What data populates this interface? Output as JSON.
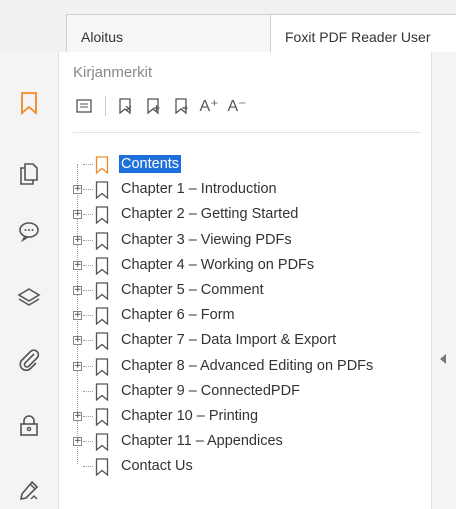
{
  "tabs": {
    "home": "Aloitus",
    "document": "Foxit PDF Reader User"
  },
  "panel": {
    "title": "Kirjanmerkit"
  },
  "icons": {
    "sidebar": [
      "bookmark-icon",
      "pages-icon",
      "comments-icon",
      "layers-icon",
      "attachments-icon",
      "security-icon",
      "signature-icon"
    ],
    "toolbar": [
      "options-icon",
      "delete-bookmark-icon",
      "add-bookmark-icon",
      "add-child-bookmark-icon",
      "increase-font-icon",
      "decrease-font-icon"
    ]
  },
  "toolbar": {
    "increase": "A⁺",
    "decrease": "A⁻"
  },
  "bookmarks": [
    {
      "label": "Contents",
      "selected": true,
      "expandable": false
    },
    {
      "label": "Chapter 1 – Introduction",
      "selected": false,
      "expandable": true
    },
    {
      "label": "Chapter 2 – Getting Started",
      "selected": false,
      "expandable": true
    },
    {
      "label": "Chapter 3 – Viewing PDFs",
      "selected": false,
      "expandable": true
    },
    {
      "label": "Chapter 4 – Working on PDFs",
      "selected": false,
      "expandable": true
    },
    {
      "label": "Chapter 5 – Comment",
      "selected": false,
      "expandable": true
    },
    {
      "label": "Chapter 6 – Form",
      "selected": false,
      "expandable": true
    },
    {
      "label": "Chapter 7 – Data Import & Export",
      "selected": false,
      "expandable": true
    },
    {
      "label": "Chapter 8 – Advanced Editing on PDFs",
      "selected": false,
      "expandable": true
    },
    {
      "label": "Chapter 9 – ConnectedPDF",
      "selected": false,
      "expandable": false
    },
    {
      "label": "Chapter 10 – Printing",
      "selected": false,
      "expandable": true
    },
    {
      "label": "Chapter 11 – Appendices",
      "selected": false,
      "expandable": true
    },
    {
      "label": "Contact Us",
      "selected": false,
      "expandable": false
    }
  ],
  "colors": {
    "accent": "#f08a24",
    "selection": "#1e6fd9"
  }
}
